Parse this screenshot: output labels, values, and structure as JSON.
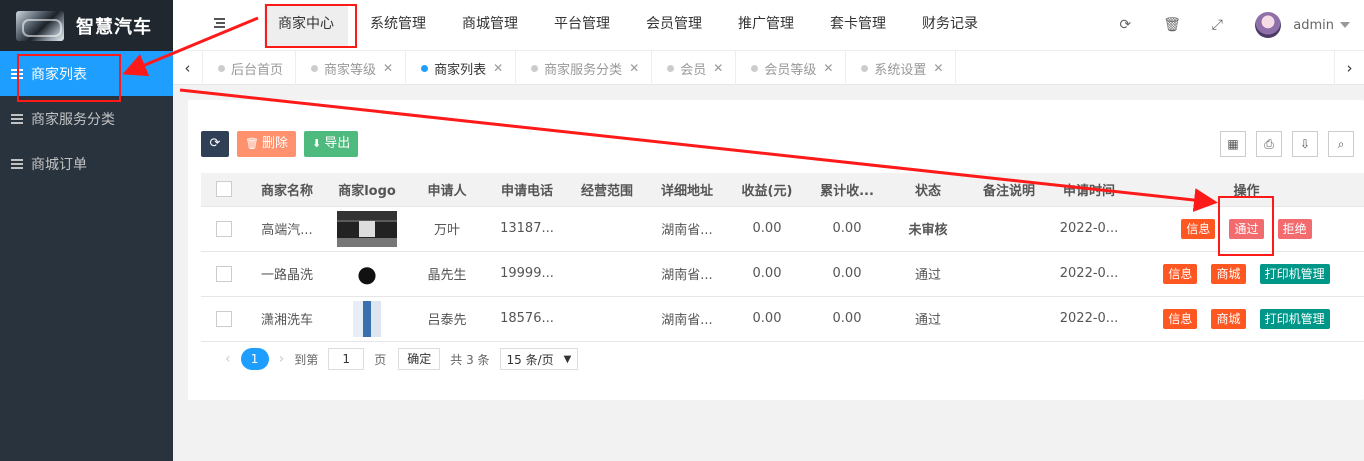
{
  "app": {
    "name": "智慧汽车"
  },
  "sidebar": {
    "items": [
      {
        "label": "商家列表",
        "active": true
      },
      {
        "label": "商家服务分类",
        "active": false
      },
      {
        "label": "商城订单",
        "active": false
      }
    ]
  },
  "header": {
    "nav": [
      "商家中心",
      "系统管理",
      "商城管理",
      "平台管理",
      "会员管理",
      "推广管理",
      "套卡管理",
      "财务记录"
    ],
    "active_nav": "商家中心",
    "user": "admin"
  },
  "tabs": {
    "items": [
      {
        "label": "后台首页",
        "closable": false,
        "active": false
      },
      {
        "label": "商家等级",
        "closable": true,
        "active": false
      },
      {
        "label": "商家列表",
        "closable": true,
        "active": true
      },
      {
        "label": "商家服务分类",
        "closable": true,
        "active": false
      },
      {
        "label": "会员",
        "closable": true,
        "active": false
      },
      {
        "label": "会员等级",
        "closable": true,
        "active": false
      },
      {
        "label": "系统设置",
        "closable": true,
        "active": false
      }
    ]
  },
  "toolbar": {
    "delete_label": "删除",
    "export_label": "导出"
  },
  "table": {
    "columns": [
      "商家名称",
      "商家logo",
      "申请人",
      "申请电话",
      "经营范围",
      "详细地址",
      "收益(元)",
      "累计收...",
      "状态",
      "备注说明",
      "申请时间",
      "操作"
    ],
    "rows": [
      {
        "name": "高端汽...",
        "applicant": "万叶",
        "phone": "13187...",
        "scope": "",
        "address": "湖南省...",
        "income": "0.00",
        "total": "0.00",
        "status": "未审核",
        "note": "",
        "time": "2022-0...",
        "ops": [
          "信息",
          "通过",
          "拒绝"
        ]
      },
      {
        "name": "一路晶洗",
        "applicant": "晶先生",
        "phone": "19999...",
        "scope": "",
        "address": "湖南省...",
        "income": "0.00",
        "total": "0.00",
        "status": "通过",
        "note": "",
        "time": "2022-0...",
        "ops": [
          "信息",
          "商城",
          "打印机管理"
        ]
      },
      {
        "name": "潇湘洗车",
        "applicant": "吕泰先",
        "phone": "18576...",
        "scope": "",
        "address": "湖南省...",
        "income": "0.00",
        "total": "0.00",
        "status": "通过",
        "note": "",
        "time": "2022-0...",
        "ops": [
          "信息",
          "商城",
          "打印机管理"
        ]
      }
    ]
  },
  "pager": {
    "current": "1",
    "goto_label": "到第",
    "page_value": "1",
    "page_unit": "页",
    "confirm": "确定",
    "total": "共 3 条",
    "size": "15 条/页"
  },
  "colors": {
    "accent": "#1e9fff",
    "sidebar_bg": "#28333e",
    "annotation": "#ff1a1a"
  }
}
